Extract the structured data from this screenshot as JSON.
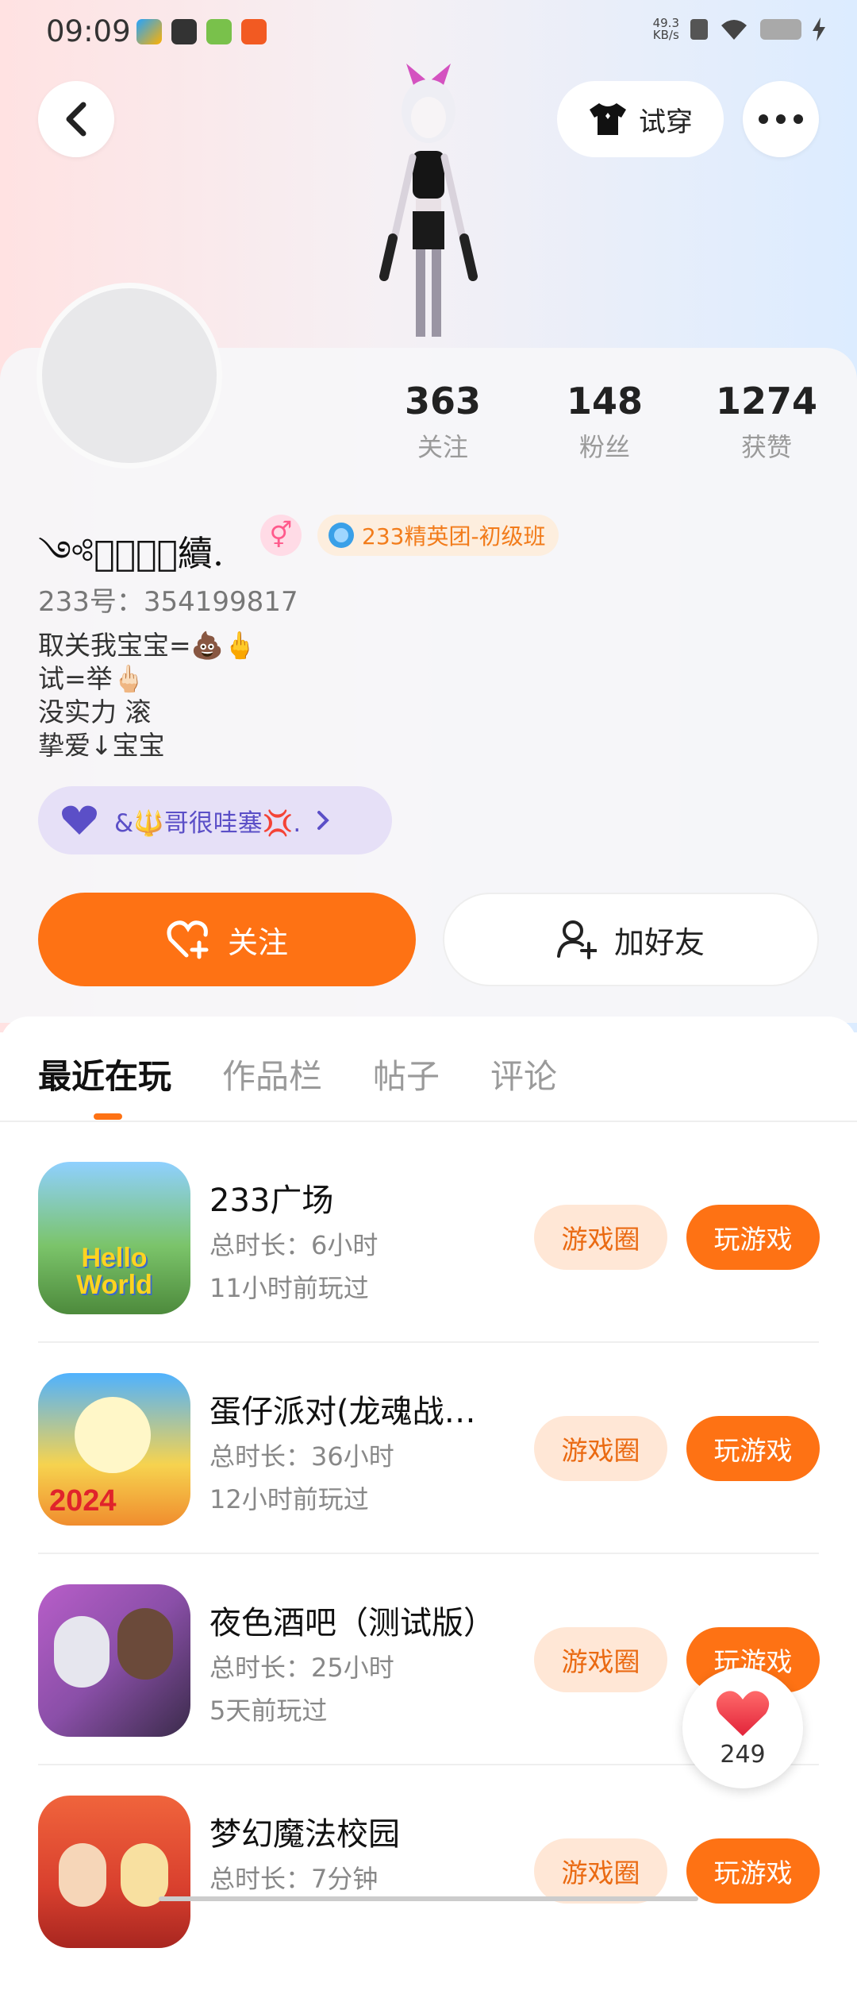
{
  "status_bar": {
    "time": "09:09",
    "net_speed_value": "49.3",
    "net_speed_unit": "KB/s"
  },
  "header": {
    "tryon_label": "试穿"
  },
  "profile": {
    "stats": [
      {
        "value": "363",
        "label": "关注"
      },
      {
        "value": "148",
        "label": "粉丝"
      },
      {
        "value": "1274",
        "label": "获赞"
      }
    ],
    "nickname": "༺情͛難͛續.",
    "gender_symbol": "⚥",
    "team_badge": "233精英团-初级班",
    "uid": "233号：354199817",
    "bio": [
      "取关我宝宝=💩🖕",
      "试=举🖕🏻",
      "没实力 滚",
      "挚爱↓宝宝"
    ],
    "group_label": "&🔱哥很哇塞💢.",
    "follow_label": "关注",
    "add_friend_label": "加好友"
  },
  "tabs": [
    "最近在玩",
    "作品栏",
    "帖子",
    "评论"
  ],
  "games": [
    {
      "title": "233广场",
      "duration": "总时长：6小时",
      "last_played": "11小时前玩过",
      "circle_label": "游戏圈",
      "play_label": "玩游戏",
      "icon_color": "#7bc46a",
      "icon_text": "Hello World"
    },
    {
      "title": "蛋仔派对(龙魂战…",
      "duration": "总时长：36小时",
      "last_played": "12小时前玩过",
      "circle_label": "游戏圈",
      "play_label": "玩游戏",
      "icon_color": "#f6d34f",
      "icon_text": "2024"
    },
    {
      "title": "夜色酒吧（测试版）",
      "duration": "总时长：25小时",
      "last_played": "5天前玩过",
      "circle_label": "游戏圈",
      "play_label": "玩游戏",
      "icon_color": "#8a4fa8",
      "icon_text": ""
    },
    {
      "title": "梦幻魔法校园",
      "duration": "总时长：7分钟",
      "last_played": "",
      "circle_label": "游戏圈",
      "play_label": "玩游戏",
      "icon_color": "#d9402e",
      "icon_text": ""
    }
  ],
  "like_fab": {
    "count": "249"
  },
  "colors": {
    "accent": "#fe7214",
    "accent_light": "#ffe7d6",
    "group_purple": "#5b4fc7"
  }
}
